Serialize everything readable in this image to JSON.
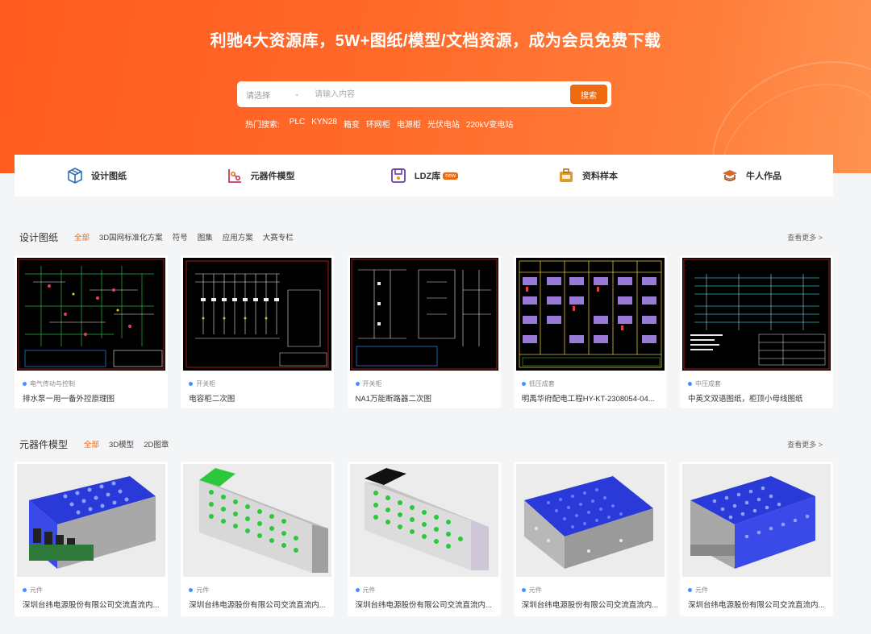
{
  "hero": {
    "title": "利驰4大资源库，5W+图纸/模型/文档资源，成为会员免费下载",
    "search": {
      "select_placeholder": "请选择",
      "input_placeholder": "请输入内容",
      "button_label": "搜索"
    },
    "hot_label": "热门搜索:",
    "hot_terms": [
      "PLC",
      "KYN28",
      "箱变",
      "环网柜",
      "电源柜",
      "光伏电站",
      "220kV变电站"
    ]
  },
  "categories": [
    {
      "label": "设计图纸",
      "icon": "box-icon"
    },
    {
      "label": "元器件模型",
      "icon": "component-icon"
    },
    {
      "label": "LDZ库",
      "icon": "library-icon",
      "badge": "new"
    },
    {
      "label": "资料样本",
      "icon": "briefcase-icon"
    },
    {
      "label": "牛人作品",
      "icon": "graduation-cap-icon"
    }
  ],
  "drawings": {
    "title": "设计图纸",
    "tabs": [
      "全部",
      "3D国网标准化方案",
      "符号",
      "图集",
      "应用方案",
      "大赛专栏"
    ],
    "active_tab": "全部",
    "more": "查看更多 >",
    "cards": [
      {
        "tag": "电气传动与控制",
        "name": "排水泵一用一备外控原理图"
      },
      {
        "tag": "开关柜",
        "name": "电容柜二次图"
      },
      {
        "tag": "开关柜",
        "name": "NA1万能断路器二次图"
      },
      {
        "tag": "低压成套",
        "name": "明禹华府配电工程HY-KT-2308054-04..."
      },
      {
        "tag": "中压成套",
        "name": "中英文双语图纸，柜顶小母线图纸"
      }
    ]
  },
  "components": {
    "title": "元器件模型",
    "tabs": [
      "全部",
      "3D模型",
      "2D图章"
    ],
    "active_tab": "全部",
    "more": "查看更多 >",
    "cards": [
      {
        "tag": "元件",
        "name": "深圳台纬电源股份有限公司交流直流内..."
      },
      {
        "tag": "元件",
        "name": "深圳台纬电源股份有限公司交流直流内..."
      },
      {
        "tag": "元件",
        "name": "深圳台纬电源股份有限公司交流直流内..."
      },
      {
        "tag": "元件",
        "name": "深圳台纬电源股份有限公司交流直流内..."
      },
      {
        "tag": "元件",
        "name": "深圳台纬电源股份有限公司交流直流内..."
      }
    ]
  },
  "colors": {
    "brand_orange": "#f0690f",
    "hero_gradient_start": "#ff5a1f",
    "hero_gradient_end": "#ff9350",
    "tag_dot": "#4a8cff"
  }
}
